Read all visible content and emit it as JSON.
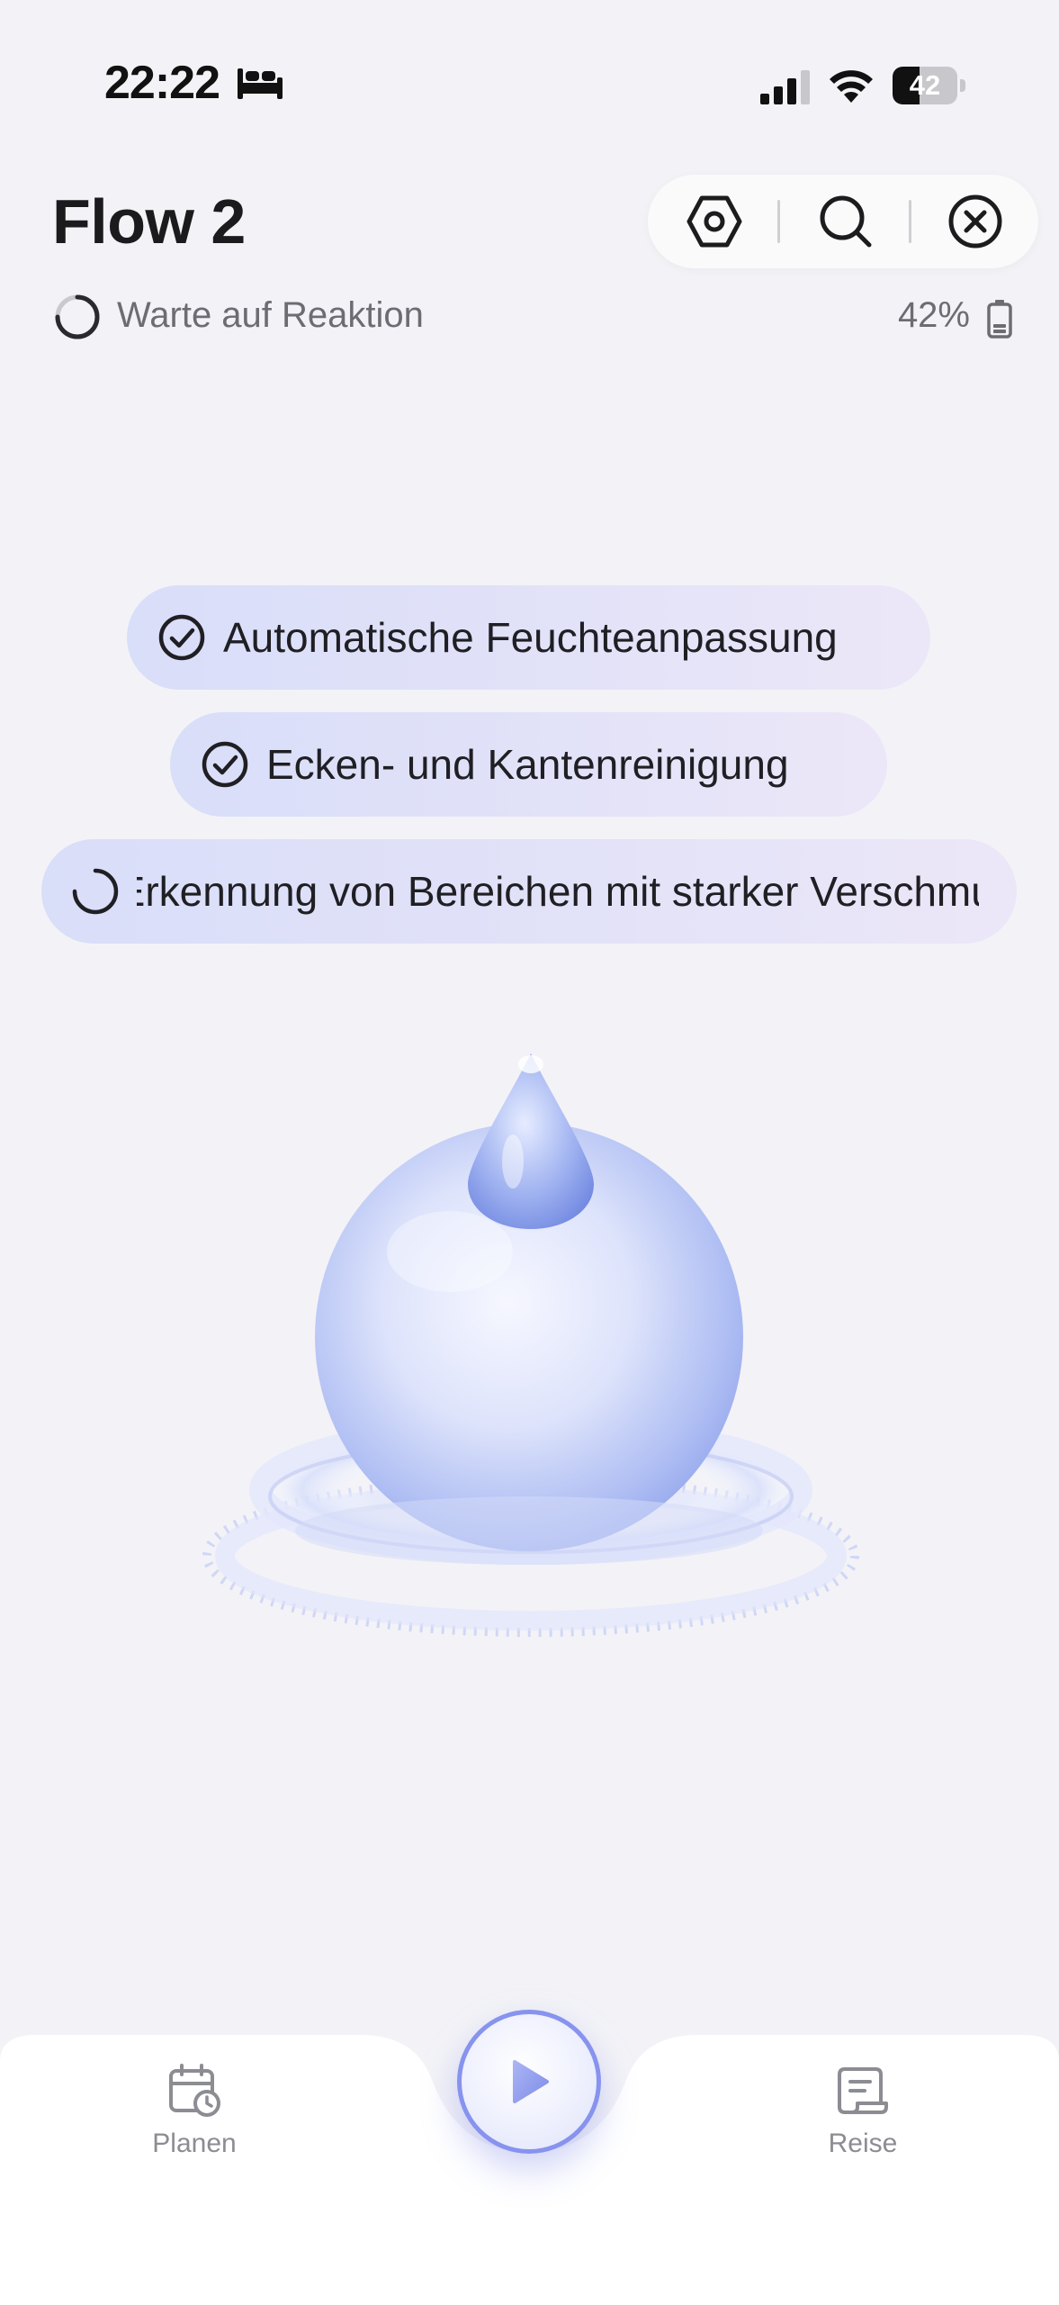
{
  "status_bar": {
    "time": "22:22",
    "bed_icon": "bed-icon",
    "signal_icon": "cellular-signal-icon",
    "wifi_icon": "wifi-icon",
    "battery_percent": "42",
    "battery_fill_fraction": 0.42
  },
  "header": {
    "title": "Flow 2",
    "actions": [
      "settings-hexagon-icon",
      "search-icon",
      "close-icon"
    ],
    "status_text": "Warte auf Reaktion",
    "device_battery": "42%"
  },
  "features": [
    {
      "label": "Automatische Feuchteanpassung",
      "state": "done"
    },
    {
      "label": "Ecken- und Kantenreinigung",
      "state": "done"
    },
    {
      "label": "Erkennung von Bereichen mit starker Verschmutzung",
      "state": "loading"
    }
  ],
  "bottom_nav": {
    "plan_label": "Planen",
    "journey_label": "Reise",
    "play_icon": "play-icon"
  },
  "colors": {
    "background": "#f3f3f7",
    "accent": "#8793ee",
    "chip_start": "#d9def9",
    "chip_end": "#ece7f8",
    "muted_text": "#6c6c72"
  }
}
